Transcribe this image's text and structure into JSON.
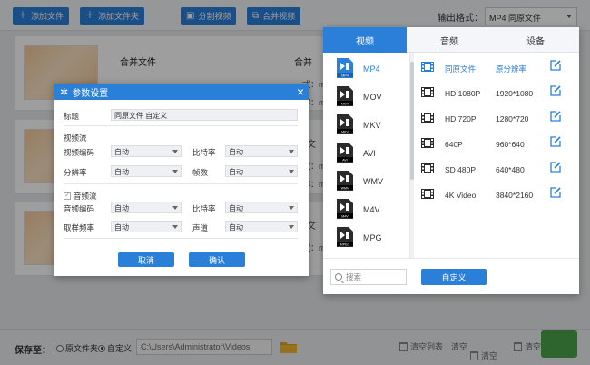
{
  "toolbar": {
    "add_file": "添加文件",
    "add_folder": "添加文件夹",
    "split_video": "分割视频",
    "merge_video": "合并视频",
    "output_format_label": "输出格式：",
    "output_format_value": "MP4  同原文件"
  },
  "files": [
    {
      "title": "合并文件"
    },
    {
      "title": ""
    },
    {
      "title": ""
    }
  ],
  "peek": {
    "merge_right": "合并",
    "rows": [
      "式：m",
      "率：m",
      "文",
      "式：m",
      "率：m",
      "文",
      "式：m"
    ]
  },
  "bottombar": {
    "save_to": "保存至：",
    "opt_source": "原文件夹",
    "opt_custom": "自定义",
    "path": "C:\\Users\\Administrator\\Videos",
    "clear_list": "清空列表",
    "clear": "清空",
    "clear_list2": "清空列",
    "clear2": "清空"
  },
  "params": {
    "title": "参数设置",
    "label_title": "标题",
    "title_value": "同原文件 自定义",
    "video_stream": "视频流",
    "video_codec": "视频编码",
    "video_codec_value": "自动",
    "bitrate": "比特率",
    "bitrate_value": "自动",
    "resolution": "分辨率",
    "resolution_value": "自动",
    "fps": "帧数",
    "fps_value": "自动",
    "audio_stream": "音频流",
    "audio_codec": "音频编码",
    "audio_codec_value": "自动",
    "audio_bitrate": "比特率",
    "audio_bitrate_value": "自动",
    "sample_rate": "取样频率",
    "sample_rate_value": "自动",
    "channel": "声道",
    "channel_value": "自动",
    "cancel": "取消",
    "confirm": "确认"
  },
  "format_panel": {
    "tabs": [
      "视频",
      "音频",
      "设备"
    ],
    "active_tab": 0,
    "formats": [
      "MP4",
      "MOV",
      "MKV",
      "AVI",
      "WMV",
      "M4V",
      "MPG"
    ],
    "format_icon_labels": [
      "MP4",
      "MOV",
      "MKV",
      "AVI",
      "WMV",
      "M4V",
      "MPEG"
    ],
    "selected_format": 0,
    "qualities": [
      {
        "name": "同原文件",
        "res": "原分辨率"
      },
      {
        "name": "HD 1080P",
        "res": "1920*1080"
      },
      {
        "name": "HD 720P",
        "res": "1280*720"
      },
      {
        "name": "640P",
        "res": "960*640"
      },
      {
        "name": "SD 480P",
        "res": "640*480"
      },
      {
        "name": "4K Video",
        "res": "3840*2160"
      }
    ],
    "selected_quality": 0,
    "search_placeholder": "搜索",
    "custom": "自定义"
  },
  "colors": {
    "accent": "#2a7fd9",
    "green": "#4aa44a"
  }
}
